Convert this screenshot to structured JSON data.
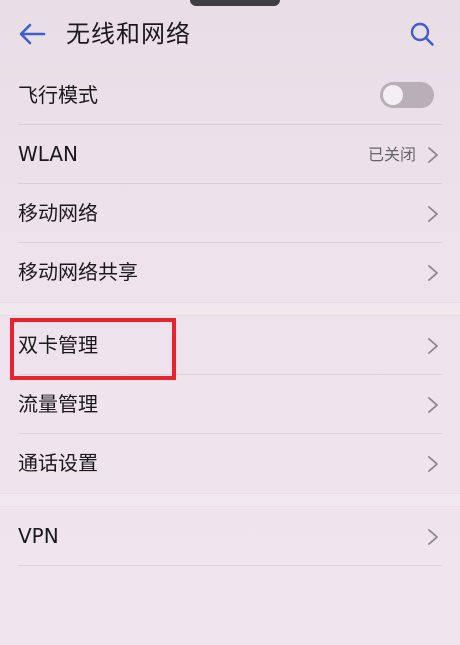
{
  "header": {
    "title": "无线和网络",
    "back_icon": "arrow-left-icon",
    "search_icon": "search-icon"
  },
  "colors": {
    "accent": "#3d5fcf",
    "highlight": "#e8232e",
    "toggle_off": "#b8b0b6"
  },
  "groups": [
    {
      "items": [
        {
          "label": "飞行模式",
          "control": "toggle",
          "state": "off"
        },
        {
          "label": "WLAN",
          "value": "已关闭",
          "control": "chevron"
        },
        {
          "label": "移动网络",
          "control": "chevron"
        },
        {
          "label": "移动网络共享",
          "control": "chevron"
        }
      ]
    },
    {
      "items": [
        {
          "label": "双卡管理",
          "control": "chevron",
          "highlighted": true
        },
        {
          "label": "流量管理",
          "control": "chevron"
        },
        {
          "label": "通话设置",
          "control": "chevron"
        }
      ]
    },
    {
      "items": [
        {
          "label": "VPN",
          "control": "chevron"
        }
      ]
    }
  ]
}
